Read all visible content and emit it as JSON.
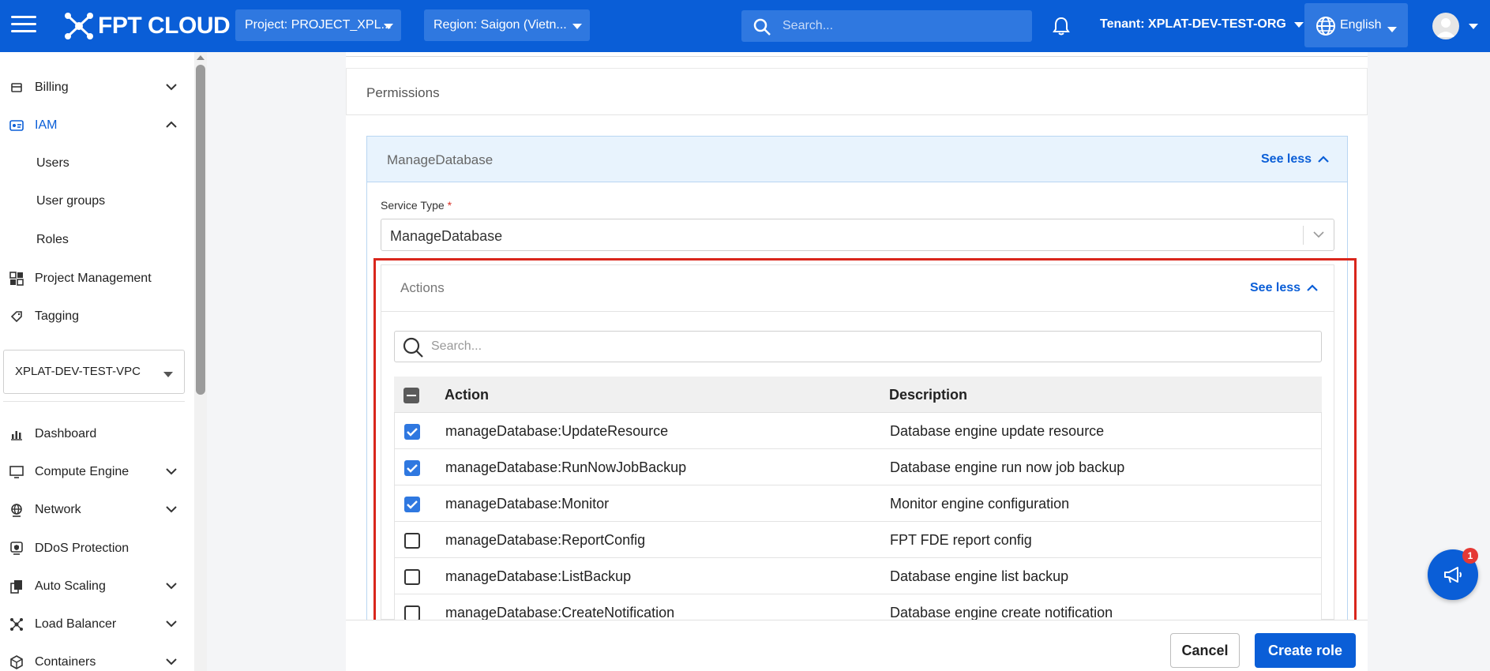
{
  "header": {
    "brand": "FPT CLOUD",
    "project_label": "Project: PROJECT_XPL...",
    "region_label": "Region: Saigon (Vietn...",
    "search_placeholder": "Search...",
    "tenant_label": "Tenant: XPLAT-DEV-TEST-ORG",
    "language": "English",
    "accent_color": "#0a5ed7"
  },
  "sidebar": {
    "billing": "Billing",
    "iam": "IAM",
    "iam_children": [
      "Users",
      "User groups",
      "Roles"
    ],
    "project_management": "Project Management",
    "tagging": "Tagging",
    "vpc": "XPLAT-DEV-TEST-VPC",
    "dashboard": "Dashboard",
    "compute_engine": "Compute Engine",
    "network": "Network",
    "ddos": "DDoS Protection",
    "auto_scaling": "Auto Scaling",
    "load_balancer": "Load Balancer",
    "containers": "Containers"
  },
  "permissions": {
    "title": "Permissions",
    "service_section_title": "ManageDatabase",
    "see_less": "See less",
    "service_type_label": "Service Type",
    "required_mark": "*",
    "service_type_value": "ManageDatabase",
    "actions": {
      "title": "Actions",
      "see_less": "See less",
      "search_placeholder": "Search...",
      "columns": {
        "action": "Action",
        "description": "Description"
      },
      "rows": [
        {
          "action": "manageDatabase:UpdateResource",
          "description": "Database engine update resource",
          "checked": true
        },
        {
          "action": "manageDatabase:RunNowJobBackup",
          "description": "Database engine run now job backup",
          "checked": true
        },
        {
          "action": "manageDatabase:Monitor",
          "description": "Monitor engine configuration",
          "checked": true
        },
        {
          "action": "manageDatabase:ReportConfig",
          "description": "FPT FDE report config",
          "checked": false
        },
        {
          "action": "manageDatabase:ListBackup",
          "description": "Database engine list backup",
          "checked": false
        },
        {
          "action": "manageDatabase:CreateNotification",
          "description": "Database engine create notification",
          "checked": false
        }
      ]
    }
  },
  "footer": {
    "cancel": "Cancel",
    "create": "Create role"
  },
  "notification_badge": "1"
}
